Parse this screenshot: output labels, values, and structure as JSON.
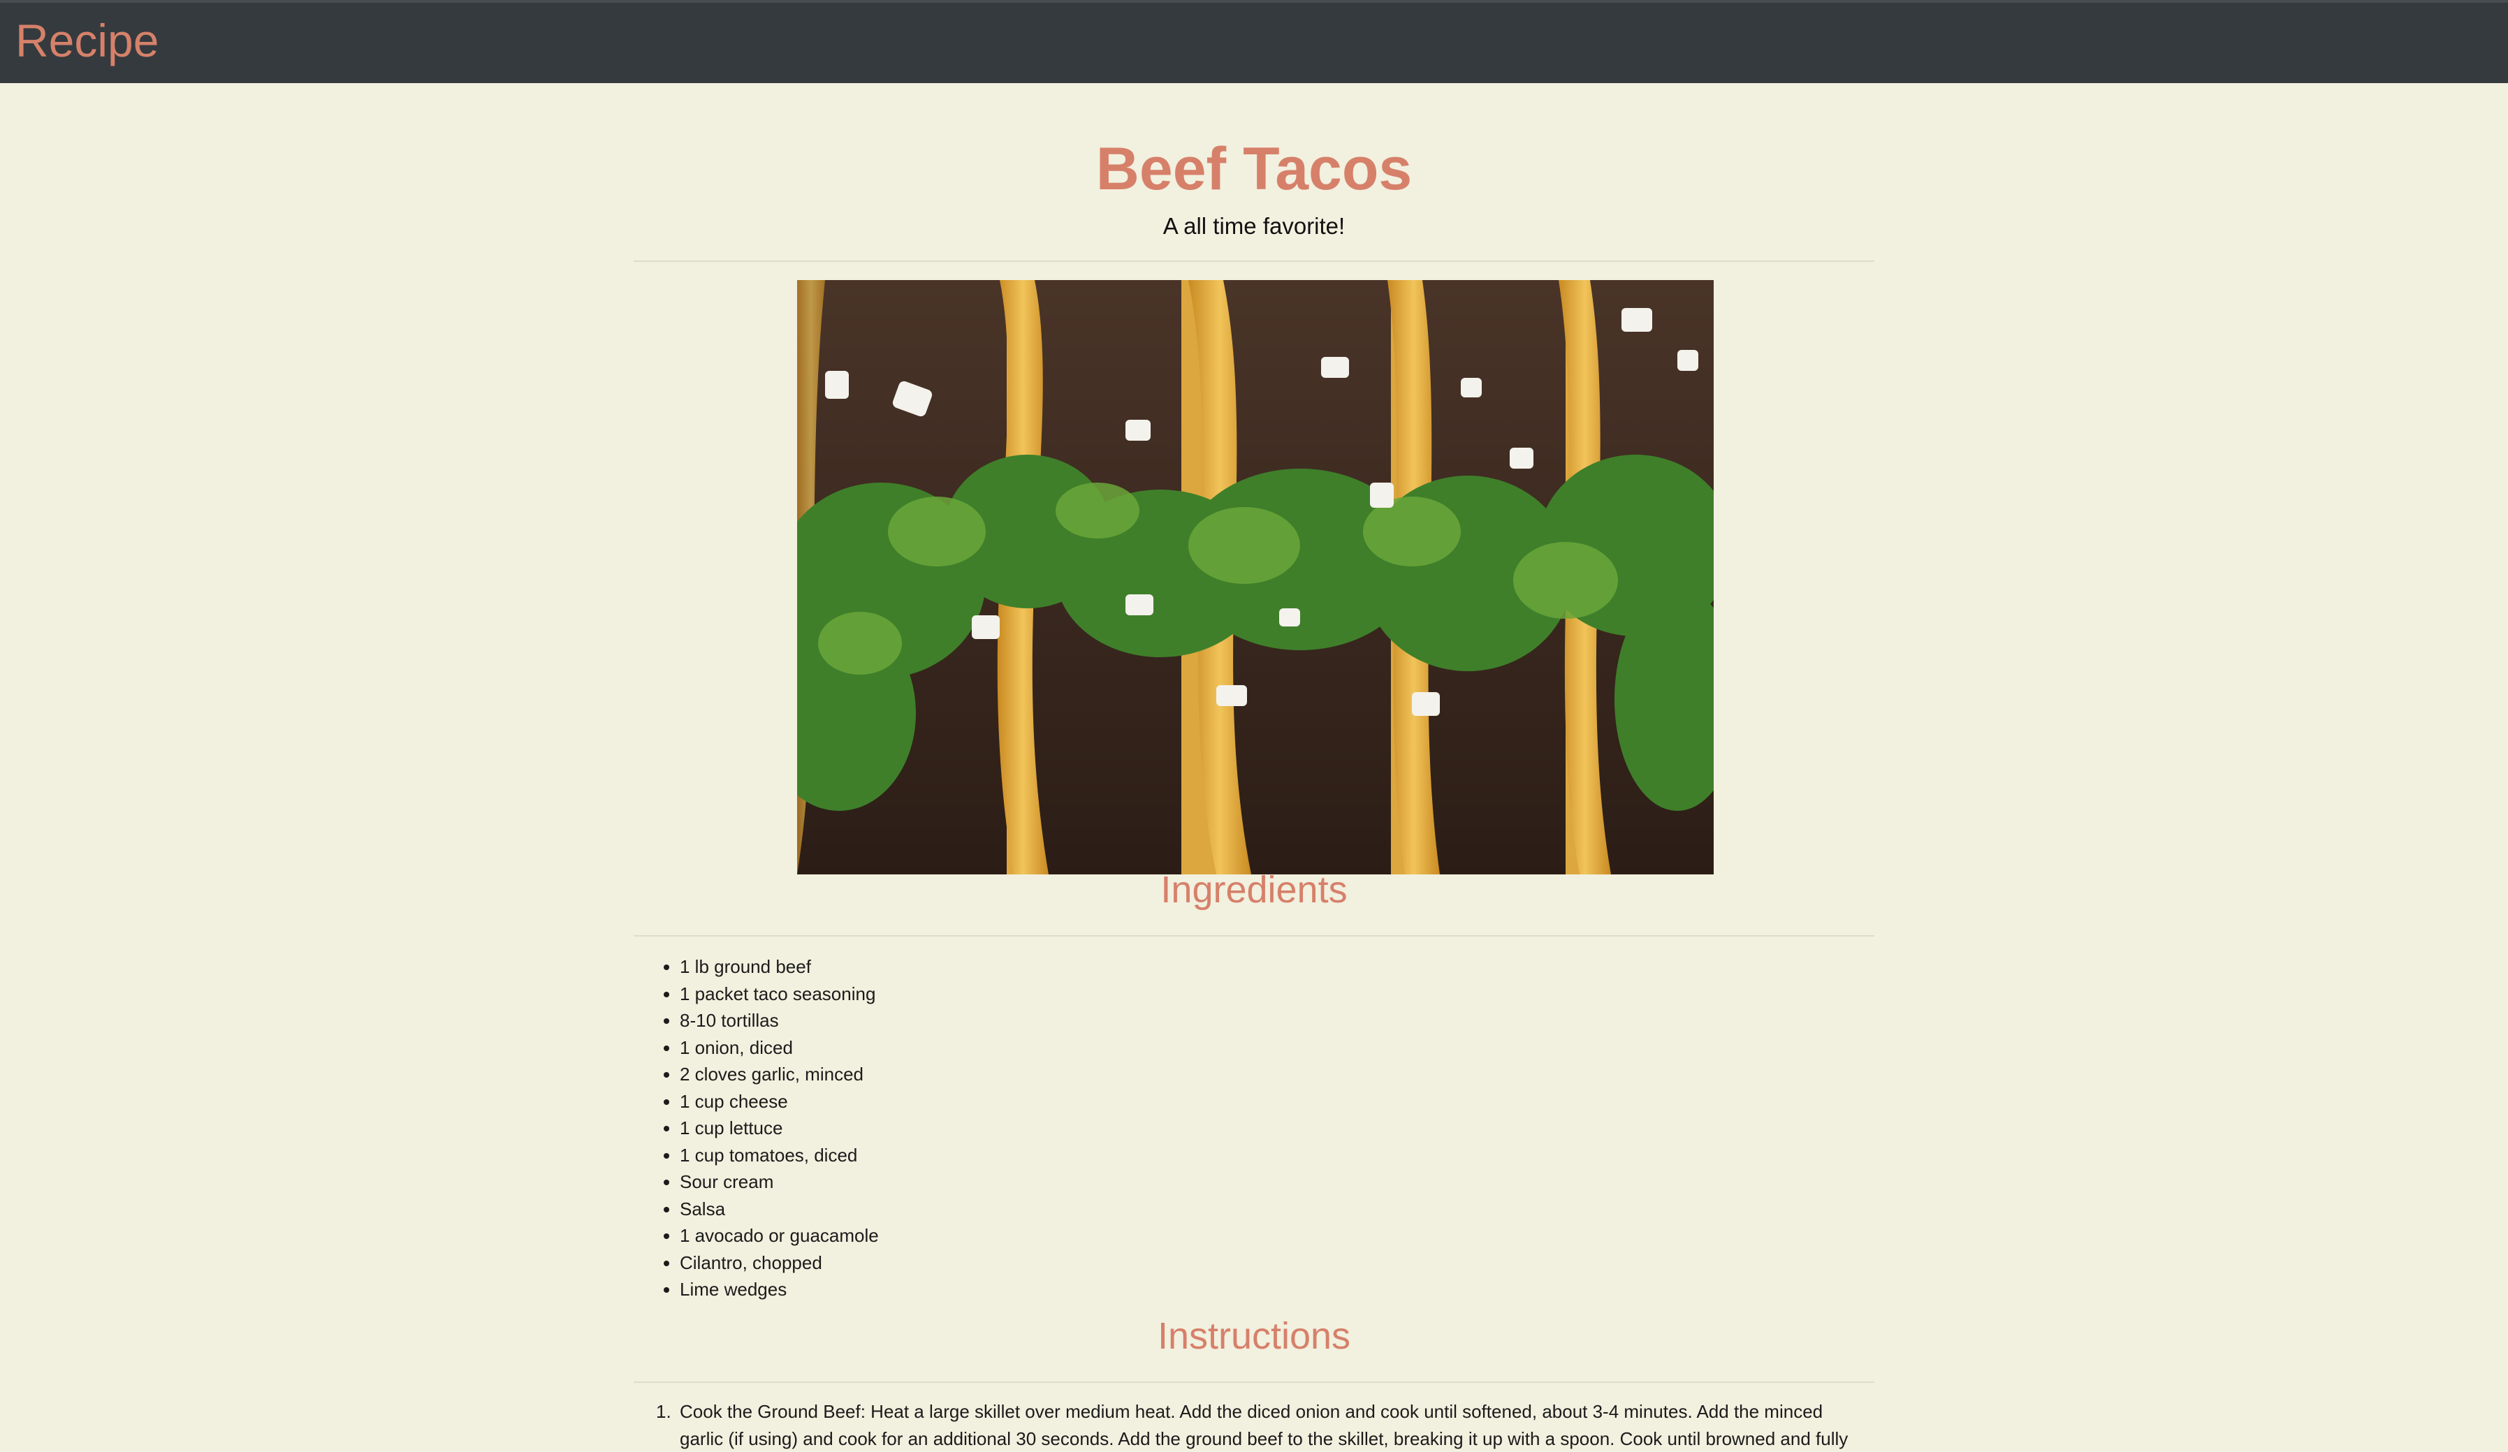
{
  "navbar": {
    "brand": "Recipe",
    "brand_color": "#d6816a",
    "background": "#353a3e"
  },
  "recipe": {
    "title": "Beef Tacos",
    "subtitle": "A all time favorite!",
    "image": {
      "subject": "beef tacos with cilantro and onion"
    }
  },
  "ingredients": {
    "heading": "Ingredients",
    "items": [
      "1 lb ground beef",
      "1 packet taco seasoning",
      "8-10 tortillas",
      "1 onion, diced",
      "2 cloves garlic, minced",
      "1 cup cheese",
      "1 cup lettuce",
      "1 cup tomatoes, diced",
      "Sour cream",
      "Salsa",
      "1 avocado or guacamole",
      "Cilantro, chopped",
      "Lime wedges"
    ]
  },
  "instructions": {
    "heading": "Instructions",
    "steps": [
      {
        "number": "1.",
        "text": "Cook the Ground Beef: Heat a large skillet over medium heat. Add the diced onion and cook until softened, about 3-4 minutes. Add the minced garlic (if using) and cook for an additional 30 seconds. Add the ground beef to the skillet, breaking it up with a spoon. Cook until browned and fully"
      }
    ]
  },
  "colors": {
    "page_background": "#f2f0df",
    "accent": "#d6806a",
    "text": "#1b1b1b"
  }
}
